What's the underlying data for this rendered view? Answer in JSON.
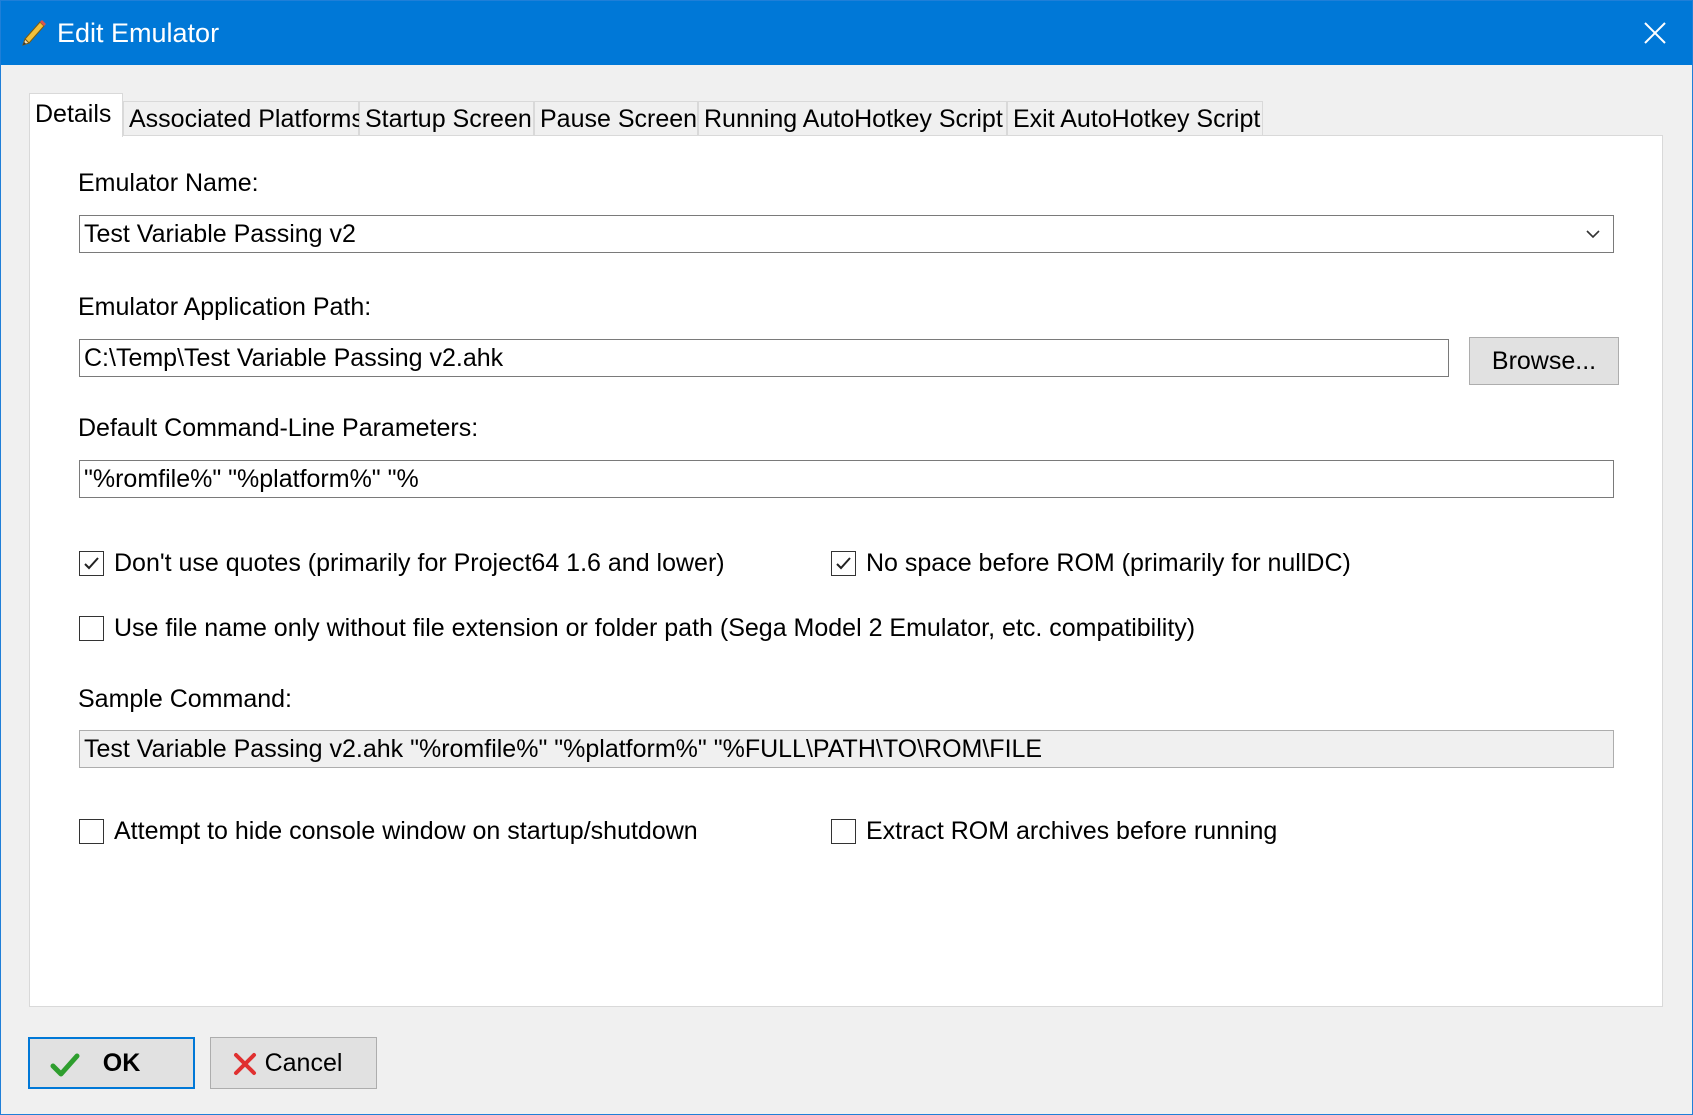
{
  "window": {
    "title": "Edit Emulator",
    "title_icon": "pencil-icon",
    "close_icon": "close-icon"
  },
  "tabs": [
    {
      "label": "Details",
      "active": true
    },
    {
      "label": "Associated Platforms",
      "active": false
    },
    {
      "label": "Startup Screen",
      "active": false
    },
    {
      "label": "Pause Screen",
      "active": false
    },
    {
      "label": "Running AutoHotkey Script",
      "active": false
    },
    {
      "label": "Exit AutoHotkey Script",
      "active": false
    }
  ],
  "details": {
    "emulator_name": {
      "label": "Emulator Name:",
      "value": "Test Variable Passing v2",
      "dropdown_icon": "chevron-down-icon"
    },
    "app_path": {
      "label": "Emulator Application Path:",
      "value": "C:\\Temp\\Test Variable Passing v2.ahk",
      "browse_label": "Browse..."
    },
    "cmd_params": {
      "label": "Default Command-Line Parameters:",
      "value": "\"%romfile%\" \"%platform%\" \"%"
    },
    "checkboxes": {
      "no_quotes": {
        "label": "Don't use quotes (primarily for Project64 1.6 and lower)",
        "checked": true
      },
      "no_space": {
        "label": "No space before ROM (primarily for nullDC)",
        "checked": true
      },
      "file_name_only": {
        "label": "Use file name only without file extension or folder path (Sega Model 2 Emulator, etc. compatibility)",
        "checked": false
      },
      "hide_console": {
        "label": "Attempt to hide console window on startup/shutdown",
        "checked": false
      },
      "extract_rom": {
        "label": "Extract ROM archives before running",
        "checked": false
      }
    },
    "sample_command": {
      "label": "Sample Command:",
      "value": "Test Variable Passing v2.ahk \"%romfile%\" \"%platform%\" \"%FULL\\PATH\\TO\\ROM\\FILE"
    }
  },
  "buttons": {
    "ok_label": "OK",
    "ok_icon": "checkmark-icon",
    "cancel_label": "Cancel",
    "cancel_icon": "x-icon"
  },
  "colors": {
    "titlebar": "#0078d7",
    "ok_check": "#2e9e2e",
    "cancel_x": "#e03030"
  }
}
